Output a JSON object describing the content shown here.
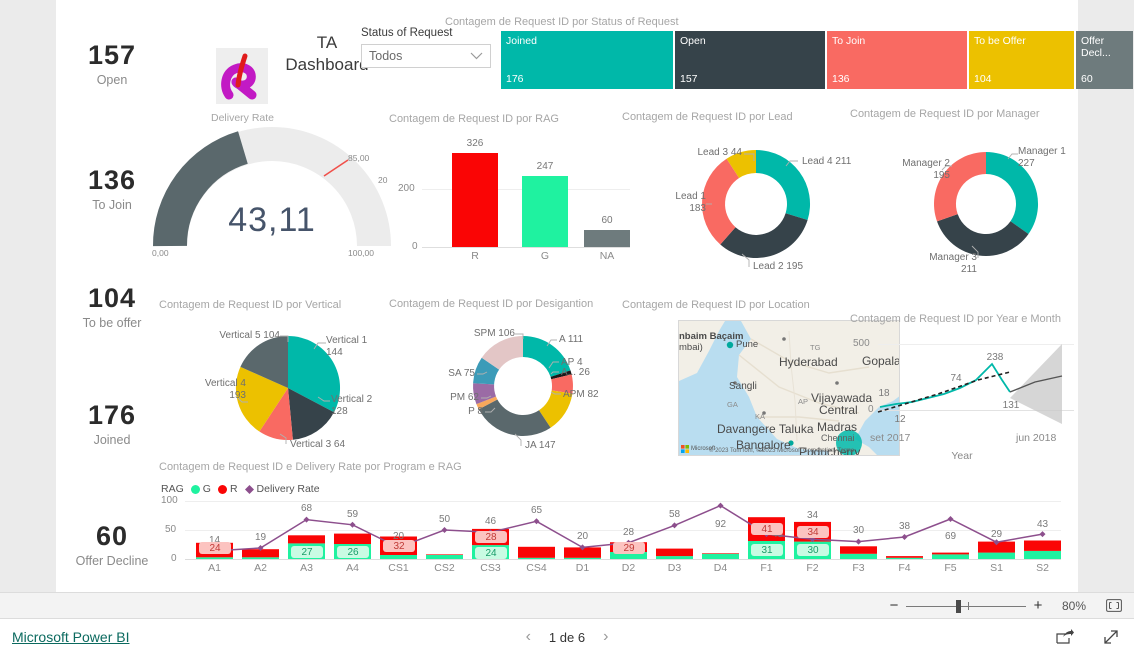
{
  "header": {
    "dashboard_title_line1": "TA",
    "dashboard_title_line2": "Dashboard",
    "logo_caption": "Delivery Rate",
    "slicer_label": "Status of Request",
    "slicer_value": "Todos",
    "chevron_icon": "chevron-down-icon"
  },
  "kpis": [
    {
      "value": "157",
      "label": "Open"
    },
    {
      "value": "136",
      "label": "To Join"
    },
    {
      "value": "104",
      "label": "To be offer"
    },
    {
      "value": "176",
      "label": "Joined"
    },
    {
      "value": "60",
      "label": "Offer Decline"
    }
  ],
  "colors": {
    "teal": "#00b8a9",
    "dark": "#36434a",
    "red_salmon": "#f96a62",
    "yellow": "#ecc100",
    "gray": "#6e7b7d",
    "bright_red": "#fa0505",
    "bright_green": "#1ff2a0",
    "purple_line": "#8d4f8d",
    "gauge_fill": "#5a686c",
    "gauge_track": "#ececec",
    "target_red": "#f0504a"
  },
  "visuals": {
    "treemap": {
      "title": "Contagem de Request ID por Status of Request",
      "chart_data": {
        "type": "bar",
        "title": "Contagem de Request ID por Status of Request",
        "categories": [
          "Joined",
          "Open",
          "To Join",
          "To be Offer",
          "Offer Decl..."
        ],
        "values": [
          176,
          157,
          136,
          104,
          60
        ],
        "colors": [
          "#00b8a9",
          "#36434a",
          "#f96a62",
          "#ecc100",
          "#6e7b7d"
        ],
        "legend": "none"
      }
    },
    "gauge": {
      "title": "",
      "chart_data": {
        "type": "gauge",
        "value": "43,11",
        "value_num": 43.11,
        "min_label": "0,00",
        "max_label": "100,00",
        "target_label": "85,00",
        "min": 0,
        "max": 100,
        "target": 85
      }
    },
    "rag_bar": {
      "title": "Contagem de Request ID por RAG",
      "chart_data": {
        "type": "bar",
        "title": "Contagem de Request ID por RAG",
        "categories": [
          "R",
          "G",
          "NA"
        ],
        "values": [
          326,
          247,
          60
        ],
        "colors": [
          "#fa0505",
          "#1ff2a0",
          "#6e7b7d"
        ],
        "ylim": [
          0,
          360
        ],
        "yticks": [
          "0",
          "200"
        ],
        "xlabel": "",
        "ylabel": ""
      }
    },
    "lead_donut": {
      "title": "Contagem de Request ID por Lead",
      "chart_data": {
        "type": "pie",
        "title": "Contagem de Request ID por Lead",
        "categories": [
          "Lead 4",
          "Lead 2",
          "Lead 1",
          "Lead 3"
        ],
        "values": [
          211,
          195,
          183,
          44
        ],
        "labels": [
          "Lead 4 211",
          "Lead 2 195",
          "Lead 1 183",
          "Lead 3 44"
        ],
        "colors": [
          "#00b8a9",
          "#36434a",
          "#f96a62",
          "#ecc100"
        ],
        "donut": true
      }
    },
    "manager_donut": {
      "title": "Contagem de Request ID por Manager",
      "chart_data": {
        "type": "pie",
        "title": "Contagem de Request ID por Manager",
        "categories": [
          "Manager 1",
          "Manager 3",
          "Manager 2"
        ],
        "values": [
          227,
          211,
          195
        ],
        "labels": [
          "Manager 1 227",
          "Manager 3 211",
          "Manager 2 195"
        ],
        "colors": [
          "#00b8a9",
          "#36434a",
          "#f96a62"
        ],
        "donut": true
      }
    },
    "vertical_pie": {
      "title": "Contagem de Request ID por Vertical",
      "chart_data": {
        "type": "pie",
        "title": "Contagem de Request ID por Vertical",
        "categories": [
          "Vertical 1",
          "Vertical 2",
          "Vertical 3",
          "Vertical 4",
          "Vertical 5"
        ],
        "values": [
          144,
          128,
          64,
          193,
          104
        ],
        "labels": [
          "Vertical 1 144",
          "Vertical 2 128",
          "Vertical 3 64",
          "Vertical 4 193",
          "Vertical 5 104"
        ],
        "colors": [
          "#00b8a9",
          "#36434a",
          "#f96a62",
          "#ecc100",
          "#6e7b7d"
        ],
        "donut": false
      }
    },
    "designation_donut": {
      "title": "Contagem de Request ID por Desigantion",
      "chart_data": {
        "type": "pie",
        "title": "Contagem de Request ID por Desigantion",
        "categories": [
          "A",
          "AP",
          "A...",
          "APM",
          "JA",
          "P",
          "PM",
          "SA",
          "SPM"
        ],
        "values": [
          111,
          4,
          26,
          82,
          147,
          8,
          62,
          75,
          106
        ],
        "labels": [
          "A 111",
          "AP 4",
          "A... 26",
          "APM 82",
          "JA 147",
          "P 8",
          "PM 62",
          "SA 75",
          "SPM 106"
        ],
        "colors": [
          "#00b8a9",
          "#1a1a1a",
          "#f96a62",
          "#ecc100",
          "#5a686c",
          "#f8a85c",
          "#9b6ba5",
          "#3c9bb8",
          "#e3c6c6"
        ],
        "donut": true
      }
    },
    "map": {
      "title": "Contagem de Request ID por Location",
      "credit": "© 2023 TomTom, © 2023 Microsoft Corporation, Terms",
      "brand": "Microsoft",
      "places": [
        "nbaim  Baçaim",
        "mbai)",
        "Pune",
        "TG",
        "Hyderabad",
        "Gopala",
        "Sangli",
        "GA",
        "AP",
        "Vijayawada",
        "Central",
        "KA",
        "Davangere Taluka",
        "Madras",
        "Chennai",
        "Bangalore",
        "Puducherry"
      ]
    },
    "forecast_line": {
      "title": "Contagem de Request ID por Year e Month",
      "chart_data": {
        "type": "line",
        "title": "Contagem de Request ID por Year e Month",
        "xlabel": "Year",
        "x_start_label": "set 2017",
        "x_end_label": "jun 2018",
        "yticks": [
          "0",
          "500"
        ],
        "ylim": [
          0,
          500
        ],
        "data_labels": [
          "18",
          "12",
          "74",
          "238",
          "131"
        ],
        "series": [
          {
            "name": "Contagem de Request ID",
            "values": [
              12,
              18,
              22,
              35,
              48,
              74,
              110,
              238,
              170,
              131
            ]
          },
          {
            "name": "Trend",
            "dashed": true,
            "values": [
              5,
              14,
              26,
              40,
              58,
              78,
              100,
              124,
              150,
              175
            ]
          }
        ],
        "forecast": true
      }
    },
    "combo": {
      "title": "Contagem de Request ID e Delivery Rate por Program e RAG",
      "legend_title": "RAG",
      "legend": [
        {
          "label": "G",
          "color": "#1ff2a0"
        },
        {
          "label": "R",
          "color": "#fa0505"
        },
        {
          "label": "Delivery Rate",
          "color": "#8d4f8d",
          "marker": "diamond"
        }
      ],
      "chart_data": {
        "type": "bar",
        "title": "Contagem de Request ID e Delivery Rate por Program e RAG",
        "categories": [
          "A1",
          "A2",
          "A3",
          "A4",
          "CS1",
          "CS2",
          "CS3",
          "CS4",
          "D1",
          "D2",
          "D3",
          "D4",
          "F1",
          "F2",
          "F3",
          "F4",
          "F5",
          "S1",
          "S2"
        ],
        "yticks": [
          "0",
          "50",
          "100"
        ],
        "ylim": [
          0,
          100
        ],
        "series": [
          {
            "name": "G",
            "color": "#1ff2a0",
            "values": [
              3,
              3,
              27,
              26,
              7,
              7,
              24,
              2,
              2,
              12,
              5,
              9,
              31,
              30,
              9,
              2,
              8,
              11,
              14
            ]
          },
          {
            "name": "R",
            "color": "#fa0505",
            "values": [
              25,
              14,
              14,
              18,
              32,
              1,
              28,
              19,
              18,
              17,
              13,
              1,
              41,
              34,
              13,
              3,
              3,
              19,
              18
            ]
          }
        ],
        "line_series": {
          "name": "Delivery Rate",
          "color": "#8d4f8d",
          "values": [
            14,
            19,
            68,
            59,
            20,
            50,
            46,
            65,
            20,
            28,
            58,
            92,
            43,
            34,
            30,
            38,
            69,
            29,
            43
          ]
        },
        "line_labels": [
          "14",
          "19",
          "68",
          "59",
          "20",
          "50",
          "46",
          "65",
          "20",
          "28",
          "58",
          "92",
          "43",
          "34",
          "30",
          "38",
          "69",
          "29",
          "43"
        ],
        "bar_pills": [
          {
            "category": "A1",
            "value": "24",
            "series": "R"
          },
          {
            "category": "A3",
            "value": "27",
            "series": "G"
          },
          {
            "category": "A4",
            "value": "26",
            "series": "G"
          },
          {
            "category": "CS1",
            "value": "32",
            "series": "R"
          },
          {
            "category": "CS3",
            "value": "28",
            "series": "R"
          },
          {
            "category": "CS3",
            "value": "24",
            "series": "G"
          },
          {
            "category": "D2",
            "value": "29",
            "series": "R"
          },
          {
            "category": "F1",
            "value": "41",
            "series": "R"
          },
          {
            "category": "F1",
            "value": "31",
            "series": "G"
          },
          {
            "category": "F2",
            "value": "34",
            "series": "R"
          },
          {
            "category": "F2",
            "value": "30",
            "series": "G"
          }
        ]
      }
    }
  },
  "statusbar": {
    "zoom_out_icon": "minus-icon",
    "zoom_in_icon": "plus-icon",
    "zoom_percent": "80%",
    "fit_icon": "fit-to-page-icon"
  },
  "footer": {
    "brand": "Microsoft Power BI",
    "prev_icon": "chevron-left-icon",
    "page_label": "1 de 6",
    "next_icon": "chevron-right-icon",
    "share_icon": "share-icon",
    "fullscreen_icon": "fullscreen-icon"
  }
}
